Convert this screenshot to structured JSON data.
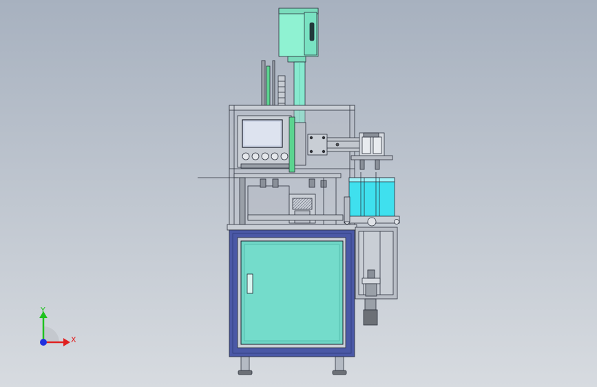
{
  "viewport": {
    "background_top": "#a7b1bf",
    "background_bottom": "#d7dbe0"
  },
  "model": {
    "colors": {
      "frame_line": "#2a2f3a",
      "cabinet_blue": "#4a58a6",
      "cabinet_blue_dark": "#2f3a7a",
      "door_glass": "#6fd6c6",
      "door_glass_dark": "#4fb7a8",
      "top_box": "#8ff2d2",
      "cylinder_cyan": "#3fe0ee",
      "panel_gray": "#b9bec6",
      "steel": "#9aa0a8",
      "green_bar": "#5bd48f",
      "screen": "#cfd7e8",
      "foot": "#6c7076"
    }
  },
  "triad": {
    "x_label": "X",
    "y_label": "Y",
    "x_color": "#e02020",
    "y_color": "#1fc21f",
    "z_color": "#2030e0"
  }
}
